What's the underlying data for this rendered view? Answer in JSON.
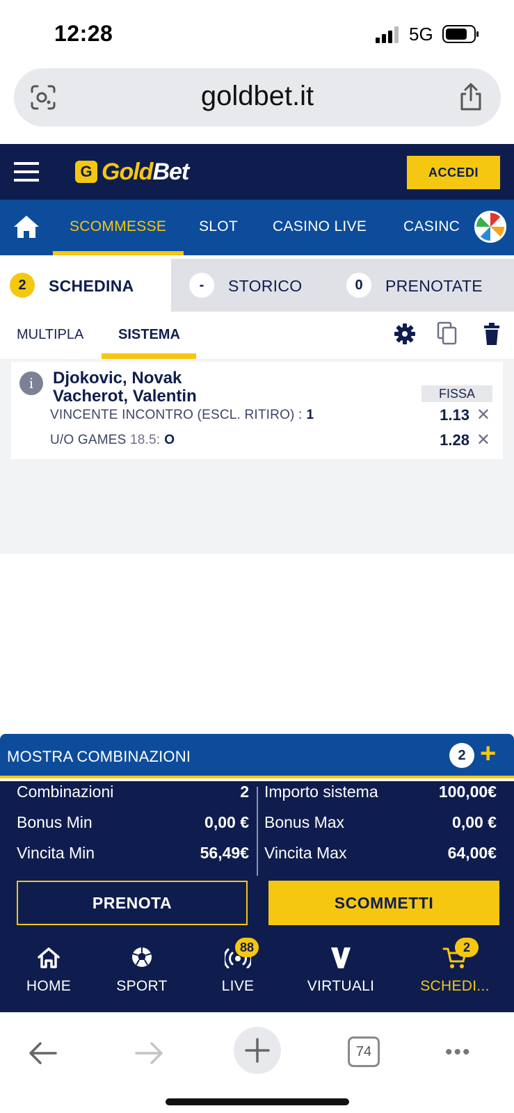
{
  "status_bar": {
    "time": "12:28",
    "network": "5G"
  },
  "browser": {
    "url": "goldbet.it",
    "tab_count": "74"
  },
  "header": {
    "logo_gold": "Gold",
    "logo_bet": "Bet",
    "logo_mark": "G",
    "login_label": "ACCEDI"
  },
  "nav": {
    "items": [
      "SCOMMESSE",
      "SLOT",
      "CASINO LIVE",
      "CASINC"
    ],
    "active": "SCOMMESSE"
  },
  "slip_tabs": [
    {
      "badge": "2",
      "label": "SCHEDINA"
    },
    {
      "badge": "-",
      "label": "STORICO"
    },
    {
      "badge": "0",
      "label": "PRENOTATE"
    }
  ],
  "sub_tabs": {
    "multipla": "MULTIPLA",
    "sistema": "SISTEMA"
  },
  "bet": {
    "player1": "Djokovic, Novak",
    "player2": "Vacherot, Valentin",
    "tag": "FISSA",
    "selections": [
      {
        "market": "VINCENTE INCONTRO (ESCL. RITIRO) :",
        "extra": "",
        "pick": "1",
        "odd": "1.13"
      },
      {
        "market": "U/O GAMES",
        "extra": "18.5:",
        "pick": "O",
        "odd": "1.28"
      }
    ]
  },
  "combinations": {
    "label": "MOSTRA COMBINAZIONI",
    "count": "2"
  },
  "summary": {
    "left": [
      {
        "label": "Combinazioni",
        "value": "2"
      },
      {
        "label": "Bonus Min",
        "value": "0,00 €"
      },
      {
        "label": "Vincita Min",
        "value": "56,49€"
      }
    ],
    "right": [
      {
        "label": "Importo sistema",
        "value": "100,00€"
      },
      {
        "label": "Bonus Max",
        "value": "0,00 €"
      },
      {
        "label": "Vincita Max",
        "value": "64,00€"
      }
    ],
    "prenota_label": "PRENOTA",
    "scommetti_label": "SCOMMETTI"
  },
  "bottom_nav": [
    {
      "label": "HOME",
      "icon": "house-icon"
    },
    {
      "label": "SPORT",
      "icon": "soccer-ball-icon"
    },
    {
      "label": "LIVE",
      "icon": "live-broadcast-icon",
      "badge": "88"
    },
    {
      "label": "VIRTUALI",
      "icon": "virtual-v-icon"
    },
    {
      "label": "SCHEDI...",
      "icon": "cart-icon",
      "badge": "2"
    }
  ],
  "colors": {
    "navy": "#0f1d4e",
    "blue": "#0d4c9b",
    "yellow": "#f6c711"
  }
}
